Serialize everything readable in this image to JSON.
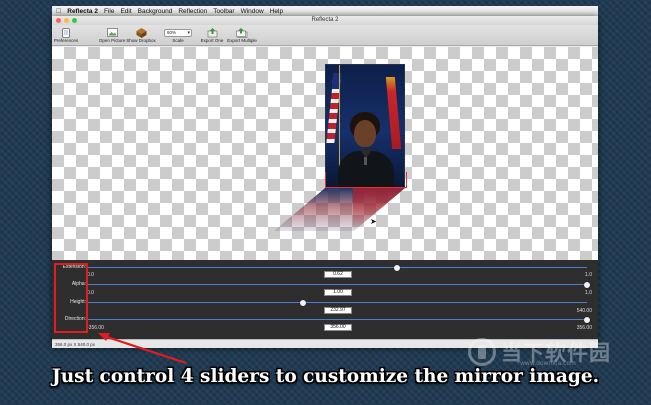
{
  "menubar": {
    "apple": "",
    "app_name": "Reflecta 2",
    "items": [
      "File",
      "Edit",
      "Background",
      "Reflection",
      "Toolbar",
      "Window",
      "Help"
    ]
  },
  "window": {
    "title": "Reflecta 2"
  },
  "toolbar": {
    "items": [
      {
        "label": "Preferences",
        "icon": "phone-icon"
      },
      {
        "label": "Open Picture",
        "icon": "picture-icon"
      },
      {
        "label": "Show Dropbox",
        "icon": "dropbox-icon"
      },
      {
        "label": "Scale",
        "icon": "scale-select"
      },
      {
        "label": "Export One",
        "icon": "export-icon"
      },
      {
        "label": "Export Multiple",
        "icon": "export-multiple-icon"
      }
    ],
    "scale_value": "60%"
  },
  "controls": {
    "sliders": [
      {
        "label": "Extension:",
        "value": "0.62",
        "min": "0.0",
        "max": "1.0",
        "fraction": 0.62
      },
      {
        "label": "Alpha:",
        "value": "1.00",
        "min": "0.0",
        "max": "1.0",
        "fraction": 1.0
      },
      {
        "label": "Height:",
        "value": "232.97",
        "min": "0.0",
        "max": "540.00",
        "fraction": 0.4314
      },
      {
        "label": "Direction:",
        "value": "356.00",
        "min": "-356.00",
        "max": "356.00",
        "fraction": 1.0
      }
    ]
  },
  "status": {
    "text": "356.0 px X 540.0 px"
  },
  "annotation": {
    "caption": "Just control 4 sliders to customize the mirror image.",
    "highlight_color": "#e21d1d"
  },
  "watermark": {
    "text": "当下软件园",
    "url": "www.downxia.com"
  },
  "colors": {
    "accent": "#4c7fd1",
    "panel": "#2e2e2e",
    "background": "#1f3a52"
  }
}
